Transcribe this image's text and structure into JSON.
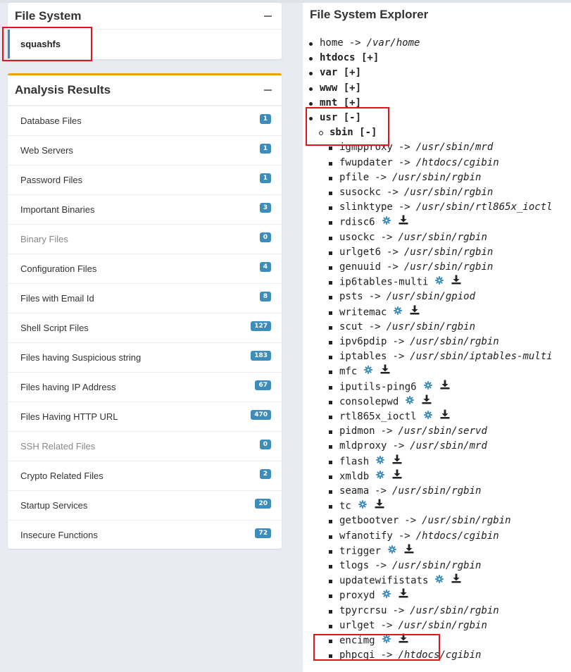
{
  "file_system": {
    "title": "File System",
    "items": [
      "squashfs"
    ]
  },
  "analysis": {
    "title": "Analysis Results",
    "rows": [
      {
        "label": "Database Files",
        "count": "1",
        "muted": false
      },
      {
        "label": "Web Servers",
        "count": "1",
        "muted": false
      },
      {
        "label": "Password Files",
        "count": "1",
        "muted": false
      },
      {
        "label": "Important Binaries",
        "count": "3",
        "muted": false
      },
      {
        "label": "Binary Files",
        "count": "0",
        "muted": true
      },
      {
        "label": "Configuration Files",
        "count": "4",
        "muted": false
      },
      {
        "label": "Files with Email Id",
        "count": "8",
        "muted": false
      },
      {
        "label": "Shell Script Files",
        "count": "127",
        "muted": false
      },
      {
        "label": "Files having Suspicious string",
        "count": "183",
        "muted": false
      },
      {
        "label": "Files having IP Address",
        "count": "67",
        "muted": false
      },
      {
        "label": "Files Having HTTP URL",
        "count": "470",
        "muted": false
      },
      {
        "label": "SSH Related Files",
        "count": "0",
        "muted": true
      },
      {
        "label": "Crypto Related Files",
        "count": "2",
        "muted": false
      },
      {
        "label": "Startup Services",
        "count": "20",
        "muted": false
      },
      {
        "label": "Insecure Functions",
        "count": "72",
        "muted": false
      }
    ]
  },
  "explorer": {
    "title": "File System Explorer",
    "top_items": [
      {
        "name": "home",
        "target": "/var/home",
        "bold": false
      },
      {
        "name": "htdocs [+]",
        "target": "",
        "bold": true
      },
      {
        "name": "var [+]",
        "target": "",
        "bold": true
      },
      {
        "name": "www [+]",
        "target": "",
        "bold": true
      },
      {
        "name": "mnt [+]",
        "target": "",
        "bold": true
      },
      {
        "name": "usr [-]",
        "target": "",
        "bold": true
      }
    ],
    "sub_dir": "sbin [-]",
    "files": [
      {
        "name": "igmpproxy",
        "target": "/usr/sbin/mrd"
      },
      {
        "name": "fwupdater",
        "target": "/htdocs/cgibin"
      },
      {
        "name": "pfile",
        "target": "/usr/sbin/rgbin"
      },
      {
        "name": "susockc",
        "target": "/usr/sbin/rgbin"
      },
      {
        "name": "slinktype",
        "target": "/usr/sbin/rtl865x_ioctl"
      },
      {
        "name": "rdisc6",
        "target": ""
      },
      {
        "name": "usockc",
        "target": "/usr/sbin/rgbin"
      },
      {
        "name": "urlget6",
        "target": "/usr/sbin/rgbin"
      },
      {
        "name": "genuuid",
        "target": "/usr/sbin/rgbin"
      },
      {
        "name": "ip6tables-multi",
        "target": ""
      },
      {
        "name": "psts",
        "target": "/usr/sbin/gpiod"
      },
      {
        "name": "writemac",
        "target": ""
      },
      {
        "name": "scut",
        "target": "/usr/sbin/rgbin"
      },
      {
        "name": "ipv6pdip",
        "target": "/usr/sbin/rgbin"
      },
      {
        "name": "iptables",
        "target": "/usr/sbin/iptables-multi"
      },
      {
        "name": "mfc",
        "target": ""
      },
      {
        "name": "iputils-ping6",
        "target": ""
      },
      {
        "name": "consolepwd",
        "target": ""
      },
      {
        "name": "rtl865x_ioctl",
        "target": ""
      },
      {
        "name": "pidmon",
        "target": "/usr/sbin/servd"
      },
      {
        "name": "mldproxy",
        "target": "/usr/sbin/mrd"
      },
      {
        "name": "flash",
        "target": ""
      },
      {
        "name": "xmldb",
        "target": ""
      },
      {
        "name": "seama",
        "target": "/usr/sbin/rgbin"
      },
      {
        "name": "tc",
        "target": ""
      },
      {
        "name": "getbootver",
        "target": "/usr/sbin/rgbin"
      },
      {
        "name": "wfanotify",
        "target": "/htdocs/cgibin"
      },
      {
        "name": "trigger",
        "target": ""
      },
      {
        "name": "tlogs",
        "target": "/usr/sbin/rgbin"
      },
      {
        "name": "updatewifistats",
        "target": ""
      },
      {
        "name": "proxyd",
        "target": ""
      },
      {
        "name": "tpyrcrsu",
        "target": "/usr/sbin/rgbin"
      },
      {
        "name": "urlget",
        "target": "/usr/sbin/rgbin"
      },
      {
        "name": "encimg",
        "target": ""
      },
      {
        "name": "phpcgi",
        "target": "/htdocs/cgibin"
      }
    ],
    "arrow": "->",
    "icons": {
      "settings": "gear-icon",
      "download": "download-icon"
    }
  },
  "colors": {
    "accent": "#3c8dbc",
    "warning_border": "#f39c12",
    "highlight": "#e3151a"
  }
}
